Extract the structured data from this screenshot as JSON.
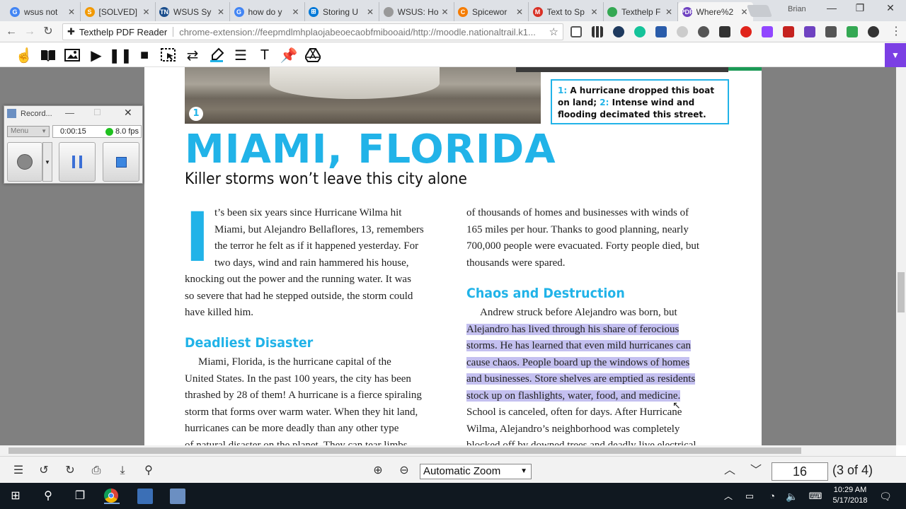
{
  "tabs": [
    {
      "title": "wsus not",
      "fav_color": "#4285f4",
      "fav": "G"
    },
    {
      "title": "[SOLVED]",
      "fav_color": "#f29900",
      "fav": "S"
    },
    {
      "title": "WSUS Sy",
      "fav_color": "#1b4e8c",
      "fav": "TN"
    },
    {
      "title": "how do y",
      "fav_color": "#4285f4",
      "fav": "G"
    },
    {
      "title": "Storing U",
      "fav_color": "#0078d7",
      "fav": "⊞"
    },
    {
      "title": "WSUS: Ho",
      "fav_color": "#999999",
      "fav": ""
    },
    {
      "title": "Spicewor",
      "fav_color": "#f57c00",
      "fav": "C"
    },
    {
      "title": "Text to Sp",
      "fav_color": "#d93025",
      "fav": "M"
    },
    {
      "title": "Texthelp F",
      "fav_color": "#34a853",
      "fav": ""
    },
    {
      "title": "Where%2",
      "fav_color": "#6f42c1",
      "fav": "PDF"
    }
  ],
  "user_name": "Brian",
  "omnibox": {
    "ext_name": "Texthelp PDF Reader",
    "url": "chrome-extension://feepmdlmhplaojabeoecaobfmibooaid/http://moodle.nationaltrail.k1..."
  },
  "recorder": {
    "title": "Record...",
    "menu": "Menu",
    "time": "0:00:15",
    "fps": "8.0 fps"
  },
  "article": {
    "caption_n1": "1:",
    "caption_t1": " A hurricane dropped this boat on land; ",
    "caption_n2": "2:",
    "caption_t2": " Intense wind and flooding decimated this street.",
    "photo_num": "1",
    "title": "MIAMI, FLORIDA",
    "subtitle": "Killer storms won’t leave this city alone",
    "dropcap": "I",
    "left_lines": [
      "t’s been six years since Hurricane Wilma hit",
      "Miami, but Alejandro Bellaflores, 13, remembers",
      "the terror he felt as if it happened yesterday. For",
      "two days, wind and rain hammered his house,",
      "knocking out the power and the running water. It was",
      "so severe that had he stepped outside, the storm could",
      "have killed him."
    ],
    "section1": "Deadliest Disaster",
    "section1_lines": [
      "Miami, Florida, is the hurricane capital of the",
      "United States. In the past 100 years, the city has been",
      "thrashed by 28 of them! A hurricane is a fierce spiraling",
      "storm that forms over warm water. When they hit land,",
      "hurricanes can be more deadly than any other type",
      "of natural disaster on the planet. They can tear limbs"
    ],
    "right_lines": [
      "of thousands of homes and businesses with winds of",
      "165 miles per hour. Thanks to good planning, nearly",
      "700,000 people were evacuated. Forty people died, but",
      "thousands were spared."
    ],
    "section2": "Chaos and Destruction",
    "section2_first": "Andrew struck before Alejandro was born, but",
    "section2_hl": [
      "Alejandro has lived through his share of ferocious",
      "storms. He has learned that even mild hurricanes can",
      "cause chaos. People board up the windows of homes",
      "and businesses. Store shelves are emptied as residents",
      "stock up on flashlights, water, food, and medicine."
    ],
    "section2_rest": [
      "School is canceled, often for days. After Hurricane",
      "Wilma, Alejandro’s neighborhood was completely",
      "blocked off by downed trees and deadly live electrical"
    ]
  },
  "pdfbar": {
    "zoom": "Automatic Zoom",
    "page": "16",
    "count": "(3 of 4)"
  },
  "clock": {
    "time": "10:29 AM",
    "date": "5/17/2018"
  }
}
